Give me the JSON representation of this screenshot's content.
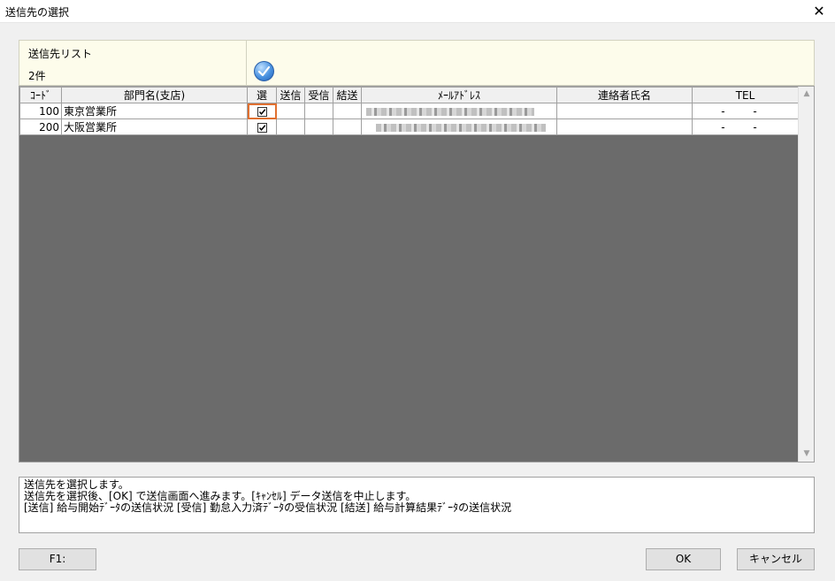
{
  "window": {
    "title": "送信先の選択"
  },
  "header": {
    "list_title": "送信先リスト",
    "count": "2件"
  },
  "table": {
    "columns": [
      "ｺｰﾄﾞ",
      "部門名(支店)",
      "選",
      "送信",
      "受信",
      "結送",
      "ﾒｰﾙｱﾄﾞﾚｽ",
      "連絡者氏名",
      "TEL"
    ],
    "rows": [
      {
        "code": "100",
        "name": "東京営業所",
        "selected": true,
        "send": "",
        "receive": "",
        "result": "",
        "contact": "",
        "tel": "- -"
      },
      {
        "code": "200",
        "name": "大阪営業所",
        "selected": true,
        "send": "",
        "receive": "",
        "result": "",
        "contact": "",
        "tel": "- -"
      }
    ]
  },
  "message": {
    "lines": [
      "送信先を選択します。",
      "送信先を選択後、[OK] で送信画面へ進みます。[ｷｬﾝｾﾙ] データ送信を中止します。",
      "[送信] 給与開始ﾃﾞｰﾀの送信状況 [受信] 勤怠入力済ﾃﾞｰﾀの受信状況 [結送] 給与計算結果ﾃﾞｰﾀの送信状況"
    ]
  },
  "buttons": {
    "f1": "F1:",
    "ok": "OK",
    "cancel": "キャンセル"
  },
  "icons": {
    "header_icon": "check-circle-icon",
    "close": "close-icon"
  },
  "colors": {
    "header_bg": "#fdfceb",
    "grid_bg": "#6b6b6b",
    "focus": "#e07030"
  }
}
